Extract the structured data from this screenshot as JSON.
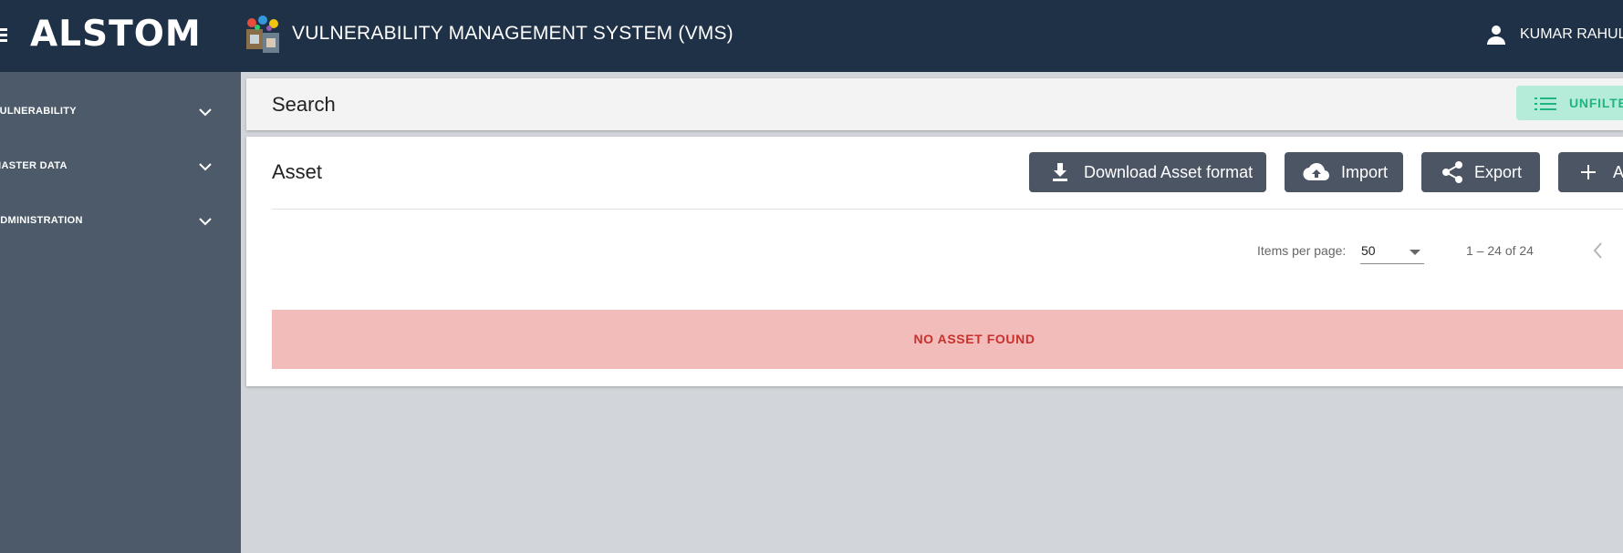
{
  "header": {
    "logo_text": "ALSTOM",
    "app_title": "VULNERABILITY MANAGEMENT SYSTEM (VMS)",
    "user_name": "KUMAR RAHUL",
    "menu_icon": "hamburger-menu-icon",
    "user_icon": "person-icon"
  },
  "sidebar": {
    "items": [
      {
        "label": "VULNERABILITY",
        "icon": "chevron-down-icon"
      },
      {
        "label": "MASTER DATA",
        "icon": "chevron-down-icon"
      },
      {
        "label": "ADMINISTRATION",
        "icon": "chevron-down-icon"
      }
    ]
  },
  "search": {
    "title": "Search",
    "unfilter_label": "UNFILTER",
    "unfilter_icon": "list-icon"
  },
  "asset": {
    "title": "Asset",
    "buttons": {
      "download": "Download Asset format",
      "import": "Import",
      "export": "Export",
      "add": "Add"
    },
    "pagination": {
      "items_per_page_label": "Items per page:",
      "items_per_page_value": "50",
      "range": "1 – 24 of 24"
    },
    "empty_message": "NO ASSET FOUND"
  },
  "colors": {
    "header_bg": "#1f3147",
    "sidebar_bg": "#4c5a69",
    "button_bg": "#4b5563",
    "unfilter_bg": "#b5ecd9",
    "unfilter_text": "#1fb57e",
    "alert_bg": "#f2bcba",
    "alert_text": "#c9302c"
  }
}
